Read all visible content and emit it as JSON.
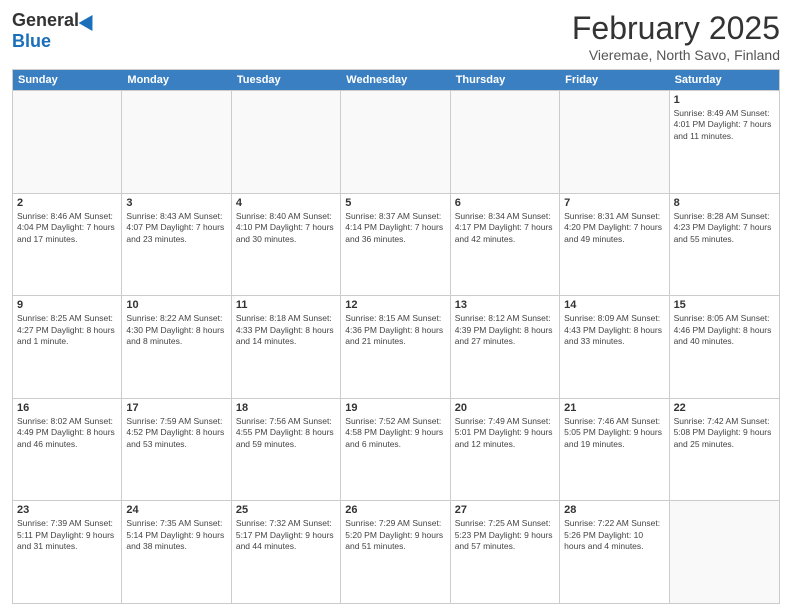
{
  "logo": {
    "general": "General",
    "blue": "Blue"
  },
  "title": "February 2025",
  "subtitle": "Vieremae, North Savo, Finland",
  "header_days": [
    "Sunday",
    "Monday",
    "Tuesday",
    "Wednesday",
    "Thursday",
    "Friday",
    "Saturday"
  ],
  "weeks": [
    [
      {
        "day": "",
        "info": ""
      },
      {
        "day": "",
        "info": ""
      },
      {
        "day": "",
        "info": ""
      },
      {
        "day": "",
        "info": ""
      },
      {
        "day": "",
        "info": ""
      },
      {
        "day": "",
        "info": ""
      },
      {
        "day": "1",
        "info": "Sunrise: 8:49 AM\nSunset: 4:01 PM\nDaylight: 7 hours\nand 11 minutes."
      }
    ],
    [
      {
        "day": "2",
        "info": "Sunrise: 8:46 AM\nSunset: 4:04 PM\nDaylight: 7 hours\nand 17 minutes."
      },
      {
        "day": "3",
        "info": "Sunrise: 8:43 AM\nSunset: 4:07 PM\nDaylight: 7 hours\nand 23 minutes."
      },
      {
        "day": "4",
        "info": "Sunrise: 8:40 AM\nSunset: 4:10 PM\nDaylight: 7 hours\nand 30 minutes."
      },
      {
        "day": "5",
        "info": "Sunrise: 8:37 AM\nSunset: 4:14 PM\nDaylight: 7 hours\nand 36 minutes."
      },
      {
        "day": "6",
        "info": "Sunrise: 8:34 AM\nSunset: 4:17 PM\nDaylight: 7 hours\nand 42 minutes."
      },
      {
        "day": "7",
        "info": "Sunrise: 8:31 AM\nSunset: 4:20 PM\nDaylight: 7 hours\nand 49 minutes."
      },
      {
        "day": "8",
        "info": "Sunrise: 8:28 AM\nSunset: 4:23 PM\nDaylight: 7 hours\nand 55 minutes."
      }
    ],
    [
      {
        "day": "9",
        "info": "Sunrise: 8:25 AM\nSunset: 4:27 PM\nDaylight: 8 hours\nand 1 minute."
      },
      {
        "day": "10",
        "info": "Sunrise: 8:22 AM\nSunset: 4:30 PM\nDaylight: 8 hours\nand 8 minutes."
      },
      {
        "day": "11",
        "info": "Sunrise: 8:18 AM\nSunset: 4:33 PM\nDaylight: 8 hours\nand 14 minutes."
      },
      {
        "day": "12",
        "info": "Sunrise: 8:15 AM\nSunset: 4:36 PM\nDaylight: 8 hours\nand 21 minutes."
      },
      {
        "day": "13",
        "info": "Sunrise: 8:12 AM\nSunset: 4:39 PM\nDaylight: 8 hours\nand 27 minutes."
      },
      {
        "day": "14",
        "info": "Sunrise: 8:09 AM\nSunset: 4:43 PM\nDaylight: 8 hours\nand 33 minutes."
      },
      {
        "day": "15",
        "info": "Sunrise: 8:05 AM\nSunset: 4:46 PM\nDaylight: 8 hours\nand 40 minutes."
      }
    ],
    [
      {
        "day": "16",
        "info": "Sunrise: 8:02 AM\nSunset: 4:49 PM\nDaylight: 8 hours\nand 46 minutes."
      },
      {
        "day": "17",
        "info": "Sunrise: 7:59 AM\nSunset: 4:52 PM\nDaylight: 8 hours\nand 53 minutes."
      },
      {
        "day": "18",
        "info": "Sunrise: 7:56 AM\nSunset: 4:55 PM\nDaylight: 8 hours\nand 59 minutes."
      },
      {
        "day": "19",
        "info": "Sunrise: 7:52 AM\nSunset: 4:58 PM\nDaylight: 9 hours\nand 6 minutes."
      },
      {
        "day": "20",
        "info": "Sunrise: 7:49 AM\nSunset: 5:01 PM\nDaylight: 9 hours\nand 12 minutes."
      },
      {
        "day": "21",
        "info": "Sunrise: 7:46 AM\nSunset: 5:05 PM\nDaylight: 9 hours\nand 19 minutes."
      },
      {
        "day": "22",
        "info": "Sunrise: 7:42 AM\nSunset: 5:08 PM\nDaylight: 9 hours\nand 25 minutes."
      }
    ],
    [
      {
        "day": "23",
        "info": "Sunrise: 7:39 AM\nSunset: 5:11 PM\nDaylight: 9 hours\nand 31 minutes."
      },
      {
        "day": "24",
        "info": "Sunrise: 7:35 AM\nSunset: 5:14 PM\nDaylight: 9 hours\nand 38 minutes."
      },
      {
        "day": "25",
        "info": "Sunrise: 7:32 AM\nSunset: 5:17 PM\nDaylight: 9 hours\nand 44 minutes."
      },
      {
        "day": "26",
        "info": "Sunrise: 7:29 AM\nSunset: 5:20 PM\nDaylight: 9 hours\nand 51 minutes."
      },
      {
        "day": "27",
        "info": "Sunrise: 7:25 AM\nSunset: 5:23 PM\nDaylight: 9 hours\nand 57 minutes."
      },
      {
        "day": "28",
        "info": "Sunrise: 7:22 AM\nSunset: 5:26 PM\nDaylight: 10 hours\nand 4 minutes."
      },
      {
        "day": "",
        "info": ""
      }
    ]
  ]
}
